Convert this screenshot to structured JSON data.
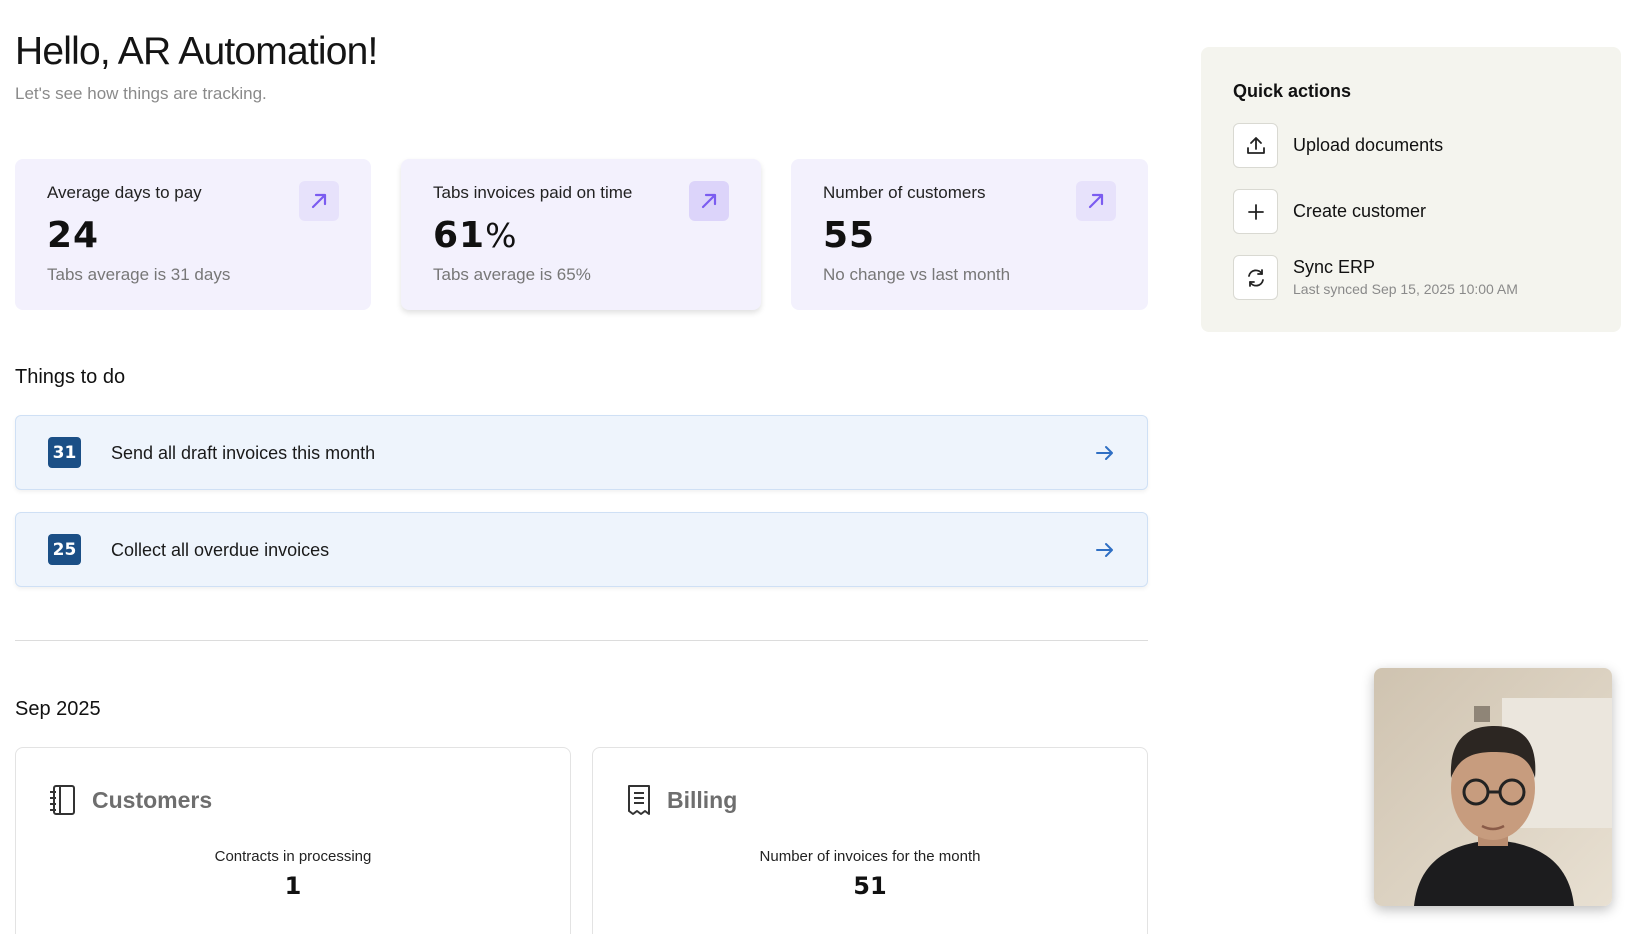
{
  "header": {
    "greeting": "Hello, AR Automation!",
    "subtitle": "Let's see how things are tracking."
  },
  "stats": [
    {
      "label": "Average days to pay",
      "value": "24",
      "unit": "",
      "note": "Tabs average is 31 days",
      "icon": "arrow-up-right-icon"
    },
    {
      "label": "Tabs invoices paid on time",
      "value": "61",
      "unit": "%",
      "note": "Tabs average is 65%",
      "icon": "arrow-up-right-icon"
    },
    {
      "label": "Number of customers",
      "value": "55",
      "unit": "",
      "note": "No change vs last month",
      "icon": "arrow-up-right-icon"
    }
  ],
  "todo": {
    "title": "Things to do",
    "items": [
      {
        "count": "31",
        "label": "Send all draft invoices this month",
        "icon": "arrow-right-icon"
      },
      {
        "count": "25",
        "label": "Collect all overdue invoices",
        "icon": "arrow-right-icon"
      }
    ]
  },
  "period": {
    "title": "Sep 2025",
    "panels": [
      {
        "title": "Customers",
        "icon": "notebook-icon",
        "metric_label": "Contracts in processing",
        "metric_value": "1"
      },
      {
        "title": "Billing",
        "icon": "receipt-icon",
        "metric_label": "Number of invoices for the month",
        "metric_value": "51"
      }
    ]
  },
  "quick_actions": {
    "title": "Quick actions",
    "items": [
      {
        "label": "Upload documents",
        "icon": "upload-icon"
      },
      {
        "label": "Create customer",
        "icon": "plus-icon"
      },
      {
        "label": "Sync ERP",
        "sub": "Last synced Sep 15, 2025 10:00 AM",
        "icon": "refresh-icon"
      }
    ]
  },
  "colors": {
    "stat_bg": "#f3f1fd",
    "stat_accent": "#7b5cf0",
    "todo_bg": "#eef4fc",
    "badge": "#1b4f86",
    "link_arrow": "#2f6fc4",
    "quick_bg": "#f4f4ee"
  }
}
